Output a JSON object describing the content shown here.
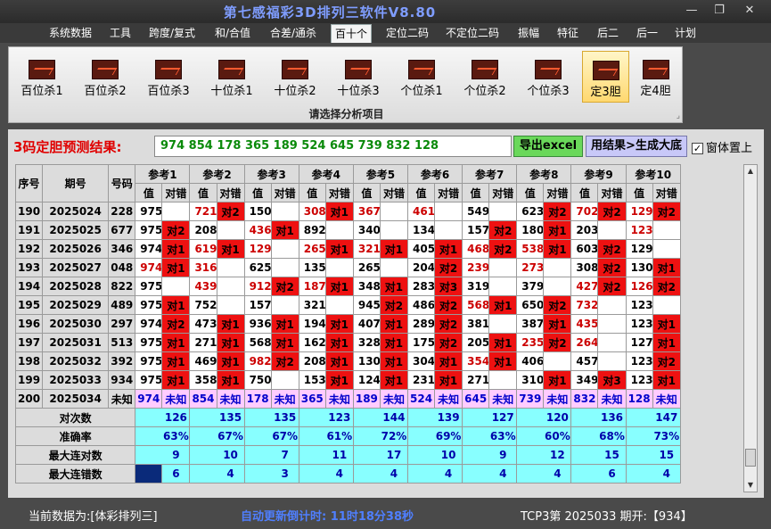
{
  "app": {
    "title": "第七感福彩3D排列三软件V8.80"
  },
  "window": {
    "minimize": "—",
    "maximize": "❐",
    "close": "✕"
  },
  "menu": [
    "系统数据",
    "工具",
    "跨度/复式",
    "和/合值",
    "合差/通杀",
    "百十个",
    "定位二码",
    "不定位二码",
    "振幅",
    "特征",
    "后二",
    "后一",
    "计划"
  ],
  "ribbon": {
    "buttons": [
      "百位杀1",
      "百位杀2",
      "百位杀3",
      "十位杀1",
      "十位杀2",
      "十位杀3",
      "个位杀1",
      "个位杀2",
      "个位杀3",
      "定3胆",
      "定4胆"
    ],
    "group_caption": "请选择分析项目",
    "corner": "⌟"
  },
  "prediction": {
    "label": "3码定胆预测结果:",
    "result": "974 854 178 365 189 524 645 739 832 128",
    "export_button": "导出excel",
    "generate_button": "用结果>生成大底",
    "topmost_check": "✓",
    "topmost_label": "窗体置上"
  },
  "table": {
    "head_fixed": [
      "序号",
      "期号",
      "号码"
    ],
    "ref_names": [
      "参考1",
      "参考2",
      "参考3",
      "参考4",
      "参考5",
      "参考6",
      "参考7",
      "参考8",
      "参考9",
      "参考10"
    ],
    "sub_value": "值",
    "sub_check": "对错",
    "rows": [
      {
        "seq": "190",
        "period": "2025024",
        "num": "228",
        "values": [
          "975",
          "721",
          "150",
          "308",
          "367",
          "461",
          "549",
          "623",
          "702",
          "129"
        ],
        "marks": [
          "",
          "对2",
          "",
          "对1",
          "",
          "",
          "",
          "对2",
          "对2",
          "对2"
        ]
      },
      {
        "seq": "191",
        "period": "2025025",
        "num": "677",
        "values": [
          "975",
          "208",
          "436",
          "892",
          "340",
          "134",
          "157",
          "180",
          "203",
          "123"
        ],
        "marks": [
          "对2",
          "",
          "对1",
          "",
          "",
          "",
          "对2",
          "对1",
          "",
          ""
        ]
      },
      {
        "seq": "192",
        "period": "2025026",
        "num": "346",
        "values": [
          "974",
          "619",
          "129",
          "265",
          "321",
          "405",
          "468",
          "538",
          "603",
          "129"
        ],
        "marks": [
          "对1",
          "对1",
          "",
          "对1",
          "对1",
          "对1",
          "对2",
          "对1",
          "对2",
          ""
        ]
      },
      {
        "seq": "193",
        "period": "2025027",
        "num": "048",
        "values": [
          "974",
          "316",
          "625",
          "135",
          "265",
          "204",
          "239",
          "273",
          "308",
          "130"
        ],
        "marks": [
          "对1",
          "",
          "",
          "",
          "",
          "对2",
          "",
          "",
          "对2",
          "对1"
        ]
      },
      {
        "seq": "194",
        "period": "2025028",
        "num": "822",
        "values": [
          "975",
          "439",
          "912",
          "187",
          "348",
          "283",
          "319",
          "379",
          "427",
          "126"
        ],
        "marks": [
          "",
          "",
          "对2",
          "对1",
          "对1",
          "对3",
          "",
          "",
          "对2",
          "对2"
        ]
      },
      {
        "seq": "195",
        "period": "2025029",
        "num": "489",
        "values": [
          "975",
          "752",
          "157",
          "321",
          "945",
          "486",
          "568",
          "650",
          "732",
          "123"
        ],
        "marks": [
          "对1",
          "",
          "",
          "",
          "对2",
          "对2",
          "对1",
          "对2",
          "",
          ""
        ]
      },
      {
        "seq": "196",
        "period": "2025030",
        "num": "297",
        "values": [
          "974",
          "473",
          "936",
          "194",
          "407",
          "289",
          "381",
          "387",
          "435",
          "123"
        ],
        "marks": [
          "对2",
          "对1",
          "对1",
          "对1",
          "对1",
          "对2",
          "",
          "对1",
          "",
          "对1"
        ]
      },
      {
        "seq": "197",
        "period": "2025031",
        "num": "513",
        "values": [
          "975",
          "271",
          "568",
          "162",
          "328",
          "175",
          "205",
          "235",
          "264",
          "127"
        ],
        "marks": [
          "对1",
          "对1",
          "对1",
          "对1",
          "对1",
          "对2",
          "对1",
          "对2",
          "",
          "对1"
        ]
      },
      {
        "seq": "198",
        "period": "2025032",
        "num": "392",
        "values": [
          "975",
          "469",
          "982",
          "208",
          "130",
          "304",
          "354",
          "406",
          "457",
          "123"
        ],
        "marks": [
          "对1",
          "对1",
          "对2",
          "对1",
          "对1",
          "对1",
          "对1",
          "",
          "",
          "对2"
        ]
      },
      {
        "seq": "199",
        "period": "2025033",
        "num": "934",
        "values": [
          "975",
          "358",
          "750",
          "153",
          "124",
          "231",
          "271",
          "310",
          "349",
          "123"
        ],
        "marks": [
          "对1",
          "对1",
          "",
          "对1",
          "对1",
          "对1",
          "",
          "对1",
          "对3",
          "对1"
        ]
      }
    ],
    "pred_row": {
      "seq": "200",
      "period": "2025034",
      "num": "未知",
      "values": [
        "974",
        "854",
        "178",
        "365",
        "189",
        "524",
        "645",
        "739",
        "832",
        "128"
      ],
      "mark": "未知"
    },
    "stats": [
      {
        "label": "对次数",
        "values": [
          "126",
          "135",
          "135",
          "123",
          "144",
          "139",
          "127",
          "120",
          "136",
          "147"
        ]
      },
      {
        "label": "准确率",
        "values": [
          "63%",
          "67%",
          "67%",
          "61%",
          "72%",
          "69%",
          "63%",
          "60%",
          "68%",
          "73%"
        ]
      },
      {
        "label": "最大连对数",
        "values": [
          "9",
          "10",
          "7",
          "11",
          "17",
          "10",
          "9",
          "12",
          "15",
          "15"
        ]
      },
      {
        "label": "最大连错数",
        "values": [
          "6",
          "4",
          "3",
          "4",
          "4",
          "4",
          "4",
          "4",
          "6",
          "4"
        ]
      }
    ]
  },
  "status": {
    "source": "当前数据为:[体彩排列三]",
    "countdown": "自动更新倒计时: 11时18分38秒",
    "issue": "TCP3第 2025033 期开:【934】"
  },
  "colors": {
    "highlight_red": "#ee1111",
    "prediction_pink": "#ffccff",
    "stats_cyan": "#88ffff",
    "title_blue": "#7f9dff",
    "status_blue": "#4f7fff"
  }
}
